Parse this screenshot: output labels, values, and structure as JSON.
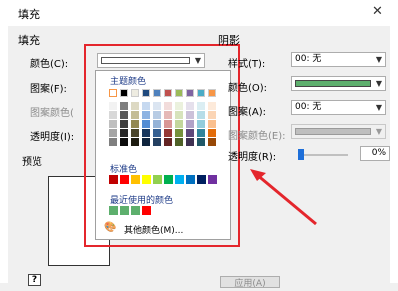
{
  "dialog": {
    "title": "填充",
    "close_glyph": "✕"
  },
  "fill": {
    "group_label": "填充",
    "color_label": "颜色(C):",
    "pattern_label": "图案(F):",
    "pattern_color_label": "图案颜色(",
    "transparency_label": "透明度(I):",
    "preview_label": "预览"
  },
  "shadow": {
    "group_label": "阴影",
    "style_label": "样式(T):",
    "style_value": "00: 无",
    "color_label": "颜色(O):",
    "color_value": "#5daf6d",
    "pattern_label": "图案(A):",
    "pattern_value": "00: 无",
    "pattern_color_label": "图案颜色(E):",
    "transparency_label": "透明度(R):",
    "transparency_value": "0%",
    "transparency_level": 0
  },
  "palette": {
    "theme_title": "主题颜色",
    "standard_title": "标准色",
    "recent_title": "最近使用的颜色",
    "more_colors_label": "其他颜色(M)...",
    "theme_top": [
      "#ffffff",
      "#000000",
      "#eeece1",
      "#1f497d",
      "#4f81bd",
      "#c0504d",
      "#9bbb59",
      "#8064a2",
      "#4bacc6",
      "#f79646"
    ],
    "theme_shades": [
      [
        "#f2f2f2",
        "#7f7f7f",
        "#ddd9c3",
        "#c6d9f0",
        "#dbe5f1",
        "#f2dcdb",
        "#ebf1dd",
        "#e5e0ec",
        "#dbeef3",
        "#fdeada"
      ],
      [
        "#d8d8d8",
        "#595959",
        "#c4bd97",
        "#8db3e2",
        "#b8cce4",
        "#e5b9b7",
        "#d7e3bc",
        "#ccc1d9",
        "#b7dde8",
        "#fbd5b5"
      ],
      [
        "#bfbfbf",
        "#3f3f3f",
        "#938953",
        "#548dd4",
        "#95b3d7",
        "#d99694",
        "#c3d69b",
        "#b2a2c7",
        "#92cddc",
        "#fac08f"
      ],
      [
        "#a5a5a5",
        "#262626",
        "#494429",
        "#17365d",
        "#366092",
        "#953734",
        "#76923c",
        "#5f497a",
        "#31859b",
        "#e36c09"
      ],
      [
        "#7f7f7f",
        "#0c0c0c",
        "#1d1b10",
        "#0f243e",
        "#244061",
        "#632423",
        "#4f6128",
        "#3f3151",
        "#205867",
        "#974806"
      ]
    ],
    "standard": [
      "#c00000",
      "#ff0000",
      "#ffc000",
      "#ffff00",
      "#92d050",
      "#00b050",
      "#00b0f0",
      "#0070c0",
      "#002060",
      "#7030a0"
    ],
    "recent": [
      "#5daf6d",
      "#5daf6d",
      "#5daf6d",
      "#ff0000"
    ]
  },
  "buttons": {
    "help": "?",
    "apply": "应用(A)"
  }
}
